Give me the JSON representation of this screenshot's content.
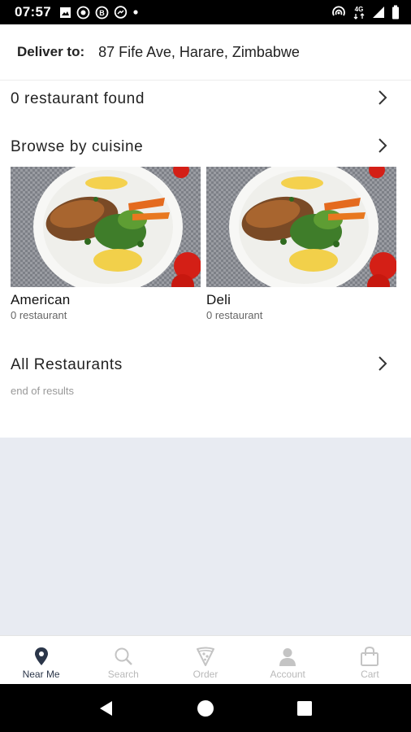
{
  "status_bar": {
    "time": "07:57",
    "network": "4G"
  },
  "header": {
    "deliver_label": "Deliver to:",
    "address": "87 Fife Ave, Harare, Zimbabwe"
  },
  "main": {
    "restaurants_found": "0 restaurant found",
    "browse_title": "Browse by cuisine",
    "cuisines": [
      {
        "name": "American",
        "count": "0 restaurant",
        "image_icon": "food-plate-image"
      },
      {
        "name": "Deli",
        "count": "0 restaurant",
        "image_icon": "food-plate-image"
      }
    ],
    "all_restaurants_title": "All Restaurants",
    "end_of_results": "end of results"
  },
  "bottom_nav": {
    "items": [
      {
        "label": "Near Me",
        "icon": "location-pin-icon",
        "active": true
      },
      {
        "label": "Search",
        "icon": "search-icon",
        "active": false
      },
      {
        "label": "Order",
        "icon": "pizza-icon",
        "active": false
      },
      {
        "label": "Account",
        "icon": "user-icon",
        "active": false
      },
      {
        "label": "Cart",
        "icon": "shopping-bag-icon",
        "active": false
      }
    ]
  },
  "colors": {
    "accent_dark": "#2b3649",
    "inactive": "#b9b9b9",
    "gray_area": "#e8ebf2"
  }
}
